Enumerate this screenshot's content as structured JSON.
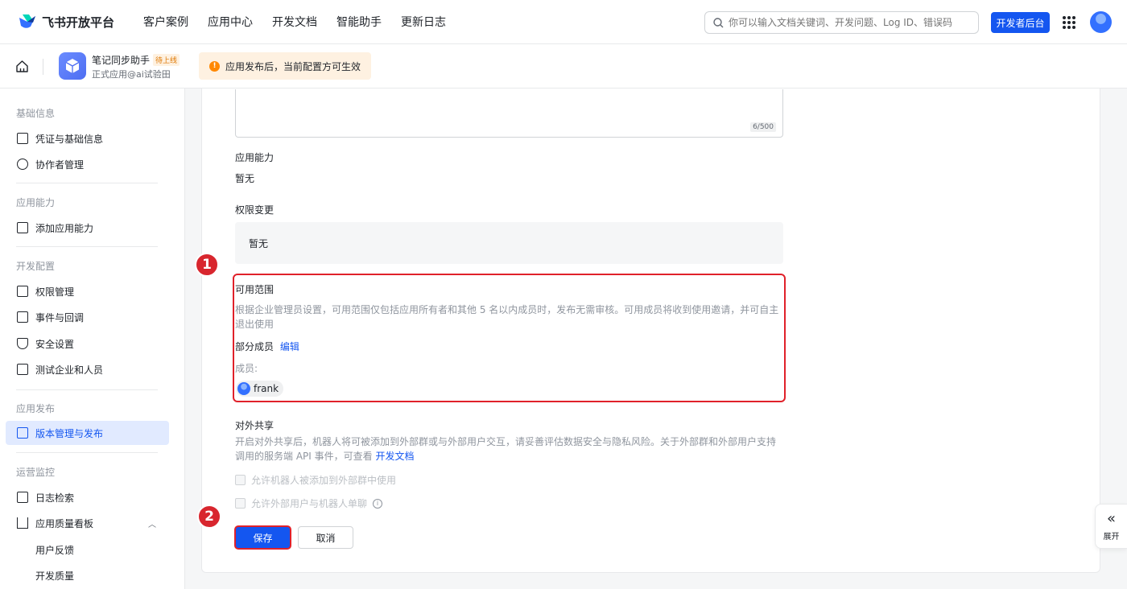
{
  "topnav": {
    "brand": "飞书开放平台",
    "items": [
      "客户案例",
      "应用中心",
      "开发文档",
      "智能助手",
      "更新日志"
    ],
    "search_placeholder": "你可以输入文档关键词、开发问题、Log ID、错误码",
    "dev_console": "开发者后台"
  },
  "subheader": {
    "app_name": "笔记同步助手",
    "app_status": "待上线",
    "app_sub": "正式应用@ai试验田",
    "notice": "应用发布后，当前配置方可生效"
  },
  "sidebar": {
    "groups": [
      {
        "title": "基础信息",
        "items": [
          "凭证与基础信息",
          "协作者管理"
        ]
      },
      {
        "title": "应用能力",
        "items": [
          "添加应用能力"
        ]
      },
      {
        "title": "开发配置",
        "items": [
          "权限管理",
          "事件与回调",
          "安全设置",
          "测试企业和人员"
        ]
      },
      {
        "title": "应用发布",
        "items": [
          "版本管理与发布"
        ]
      },
      {
        "title": "运营监控",
        "items": [
          "日志检索",
          "应用质量看板",
          "用户反馈",
          "开发质量"
        ]
      }
    ],
    "active": "版本管理与发布"
  },
  "main": {
    "char_count": "6/500",
    "capability_label": "应用能力",
    "capability_value": "暂无",
    "perm_label": "权限变更",
    "perm_value": "暂无",
    "scope_label": "可用范围",
    "scope_desc": "根据企业管理员设置，可用范围仅包括应用所有者和其他 5 名以内成员时，发布无需审核。可用成员将收到使用邀请，并可自主退出使用",
    "scope_type": "部分成员",
    "scope_edit": "编辑",
    "members_label": "成员:",
    "member_name": "frank",
    "share_label": "对外共享",
    "share_desc": "开启对外共享后，机器人将可被添加到外部群或与外部用户交互，请妥善评估数据安全与隐私风险。关于外部群和外部用户支持调用的服务端 API 事件，可查看",
    "share_link": "开发文档",
    "checkbox1": "允许机器人被添加到外部群中使用",
    "checkbox2": "允许外部用户与机器人单聊",
    "save": "保存",
    "cancel": "取消",
    "step1": "1",
    "step2": "2"
  },
  "expand_label": "展开",
  "colors": {
    "accent": "#1456f0",
    "highlight": "#e0212a",
    "notice_bg": "#fef1e1"
  }
}
